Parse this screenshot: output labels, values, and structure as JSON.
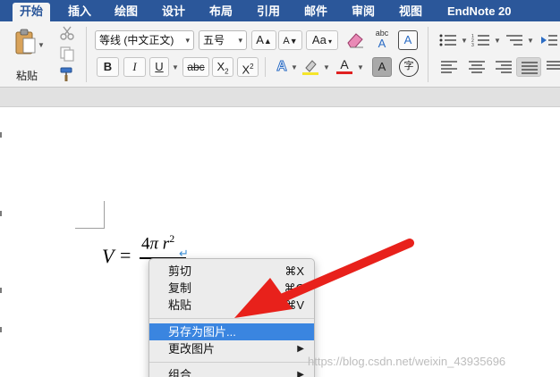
{
  "tabs": [
    "开始",
    "插入",
    "绘图",
    "设计",
    "布局",
    "引用",
    "邮件",
    "审阅",
    "视图",
    "EndNote 20"
  ],
  "clipboard": {
    "paste_label": "粘贴",
    "icons": [
      "clipboard-icon",
      "scissors-icon",
      "copy-icon",
      "format-painter-icon"
    ]
  },
  "font": {
    "name": "等线 (中文正文)",
    "size": "五号",
    "grow_label": "A",
    "shrink_label": "A",
    "case_label": "Aa",
    "phonetic_top": "abc",
    "phonetic_bottom": "A",
    "border_label": "A",
    "bold_label": "B",
    "italic_label": "I",
    "underline_label": "U",
    "strike_label": "abc",
    "subscript_label": "X",
    "subscript_small": "2",
    "superscript_label": "X",
    "superscript_small": "2",
    "effects_label": "A",
    "font_color_label": "A",
    "shade_label": "A",
    "enclose_label": "字",
    "highlight_color": "#f5e52a",
    "font_color": "#e02020"
  },
  "equation": {
    "lhs": "V",
    "eq": "=",
    "num_coef": "4",
    "num_pi": "π",
    "num_r": "r",
    "num_exp": "2",
    "return_mark": "↵"
  },
  "context_menu": {
    "items": [
      {
        "label": "剪切",
        "shortcut": "⌘X"
      },
      {
        "label": "复制",
        "shortcut": "⌘C"
      },
      {
        "label": "粘贴",
        "shortcut": "⌘V"
      },
      {
        "label": "另存为图片...",
        "shortcut": ""
      },
      {
        "label": "更改图片",
        "shortcut": ""
      },
      {
        "label": "组合",
        "shortcut": ""
      }
    ],
    "highlighted": "另存为图片..."
  },
  "watermark": "https://blog.csdn.net/weixin_43935696",
  "colors": {
    "ribbon_tab_bar": "#2b579a",
    "menu_highlight": "#3a85e0",
    "annotation_arrow": "#e8211b"
  }
}
